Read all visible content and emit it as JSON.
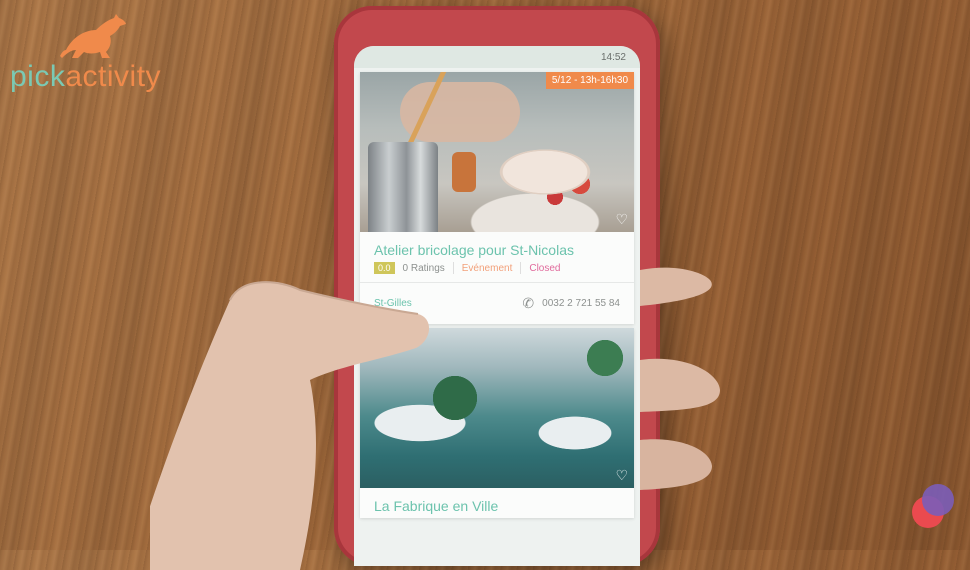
{
  "brand": {
    "part1": "pick",
    "part2": "activity"
  },
  "phone_screen": {
    "status": "14:52",
    "cards": [
      {
        "date_tag": "5/12 - 13h-16h30",
        "title": "Atelier bricolage pour St-Nicolas",
        "score": "0.0",
        "ratings": "0 Ratings",
        "type": "Evénement",
        "status": "Closed",
        "location": "St-Gilles",
        "phone": "0032 2 721 55 84"
      },
      {
        "title": "La Fabrique en Ville"
      }
    ]
  },
  "colors": {
    "accent_green": "#6cc3ad",
    "accent_orange": "#f08a4b",
    "closed_pink": "#e06a9c"
  }
}
